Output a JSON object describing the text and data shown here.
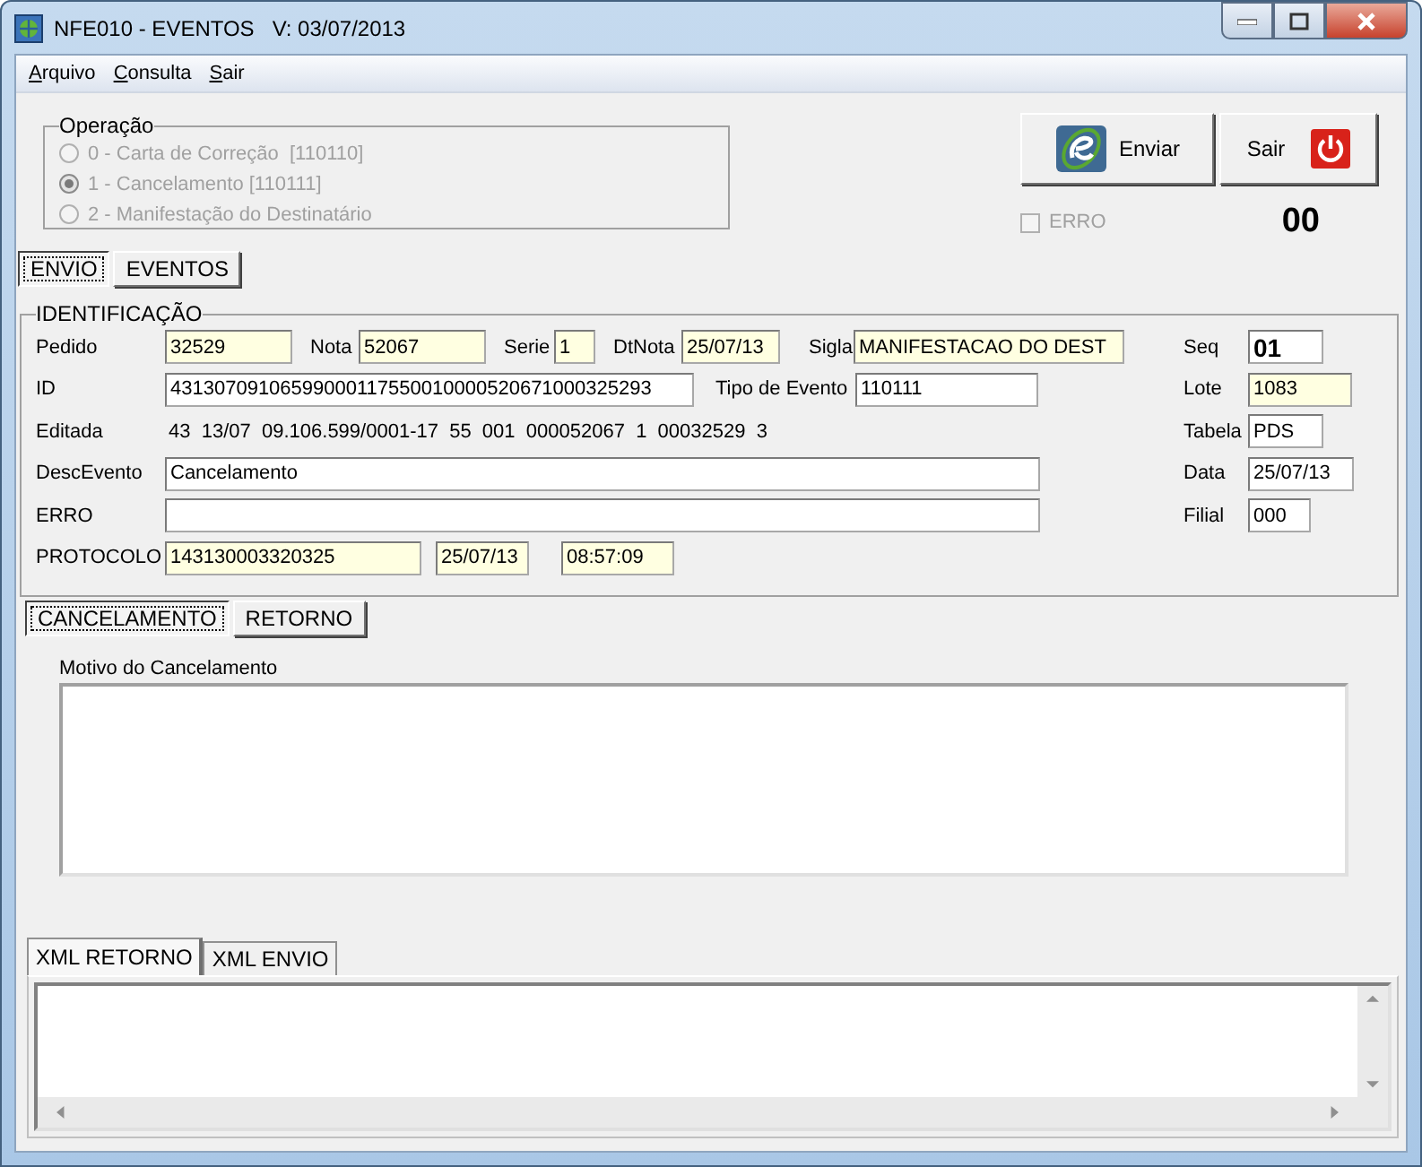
{
  "window": {
    "title": "NFE010 - EVENTOS   V: 03/07/2013"
  },
  "menu": [
    {
      "label": "Arquivo"
    },
    {
      "label": "Consulta"
    },
    {
      "label": "Sair"
    }
  ],
  "operacao": {
    "title": "Operação",
    "options": [
      {
        "label": "0 - Carta de Correção  [110110]",
        "selected": false,
        "disabled": true
      },
      {
        "label": "1 - Cancelamento [110111]",
        "selected": true,
        "disabled": true
      },
      {
        "label": "2 - Manifestação do Destinatário",
        "selected": false,
        "disabled": true
      }
    ]
  },
  "buttons": [
    {
      "kind": "send",
      "label": "Enviar"
    },
    {
      "kind": "exit",
      "label": "Sair"
    }
  ],
  "erro_checkbox": {
    "label": "ERRO",
    "checked": false,
    "disabled": true
  },
  "counter": "00",
  "main_tabs": [
    {
      "label": "ENVIO",
      "selected": true
    },
    {
      "label": "EVENTOS",
      "selected": false
    }
  ],
  "identificacao": {
    "title": "IDENTIFICAÇÃO",
    "rows": [
      {
        "items": [
          {
            "kind": "label",
            "text": "Pedido"
          },
          {
            "kind": "field",
            "value": "32529",
            "readonly": true
          },
          {
            "kind": "label",
            "text": "Nota"
          },
          {
            "kind": "field",
            "value": "52067",
            "readonly": true
          },
          {
            "kind": "label",
            "text": "Serie"
          },
          {
            "kind": "field",
            "value": "1",
            "readonly": true
          },
          {
            "kind": "label",
            "text": "DtNota"
          },
          {
            "kind": "field",
            "value": "25/07/13",
            "readonly": true
          },
          {
            "kind": "label",
            "text": "Sigla"
          },
          {
            "kind": "field",
            "value": "MANIFESTACAO DO DEST",
            "readonly": true
          }
        ]
      },
      {
        "items": [
          {
            "kind": "label",
            "text": "ID"
          },
          {
            "kind": "field",
            "value": "43130709106599000117550010000520671000325293",
            "readonly": false
          },
          {
            "kind": "label",
            "text": "Tipo de Evento"
          },
          {
            "kind": "field",
            "value": "110111",
            "readonly": false
          }
        ]
      },
      {
        "items": [
          {
            "kind": "label",
            "text": "Editada"
          },
          {
            "kind": "text",
            "text": "43  13/07  09.106.599/0001-17  55  001  000052067  1  00032529  3"
          }
        ]
      },
      {
        "items": [
          {
            "kind": "label",
            "text": "DescEvento"
          },
          {
            "kind": "field",
            "value": "Cancelamento",
            "readonly": false
          }
        ]
      },
      {
        "items": [
          {
            "kind": "label",
            "text": "ERRO"
          },
          {
            "kind": "field",
            "value": "",
            "readonly": false
          }
        ]
      },
      {
        "items": [
          {
            "kind": "label",
            "text": "PROTOCOLO"
          },
          {
            "kind": "field",
            "value": "143130003320325",
            "readonly": true
          },
          {
            "kind": "field",
            "value": "25/07/13",
            "readonly": true
          },
          {
            "kind": "field",
            "value": "08:57:09",
            "readonly": true
          }
        ]
      }
    ],
    "side": [
      {
        "label": "Seq",
        "value": "01",
        "readonly": false,
        "bold": true
      },
      {
        "label": "Lote",
        "value": "1083",
        "readonly": true,
        "bold": false
      },
      {
        "label": "Tabela",
        "value": "PDS",
        "readonly": false,
        "bold": false
      },
      {
        "label": "Data",
        "value": "25/07/13",
        "readonly": false,
        "bold": false
      },
      {
        "label": "Filial",
        "value": "000",
        "readonly": false,
        "bold": false
      }
    ]
  },
  "sub_tabs": [
    {
      "label": "CANCELAMENTO",
      "selected": true
    },
    {
      "label": "RETORNO",
      "selected": false
    }
  ],
  "motivo": {
    "label": "Motivo do Cancelamento"
  },
  "xml_tabs": [
    {
      "label": "XML RETORNO",
      "selected": true
    },
    {
      "label": "XML ENVIO",
      "selected": false
    }
  ]
}
